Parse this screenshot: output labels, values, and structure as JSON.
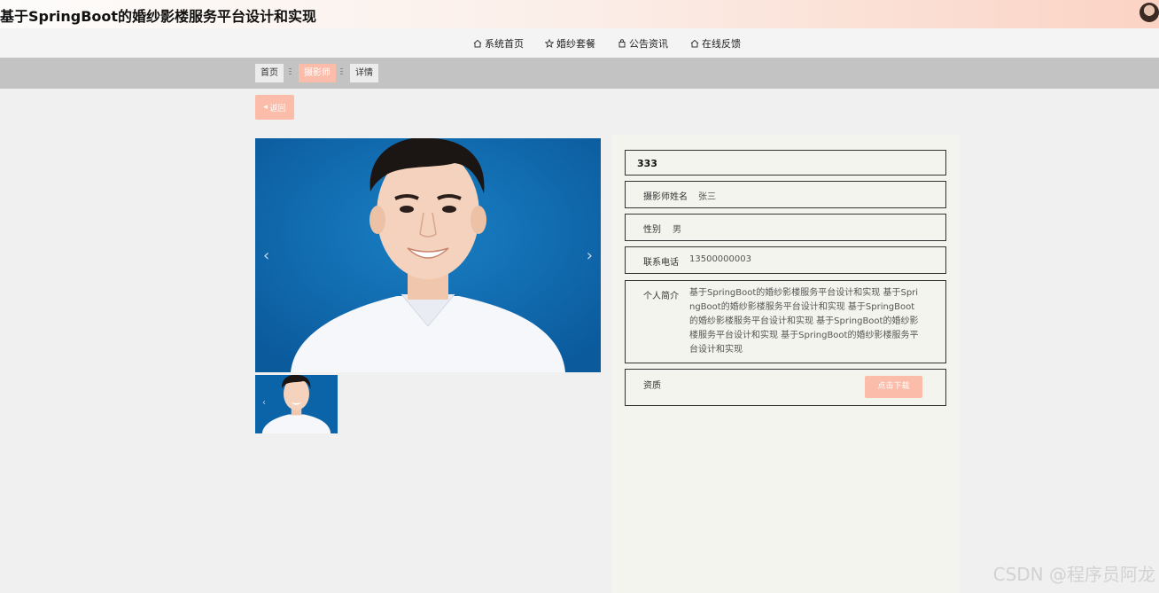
{
  "header": {
    "site_title": "基于SpringBoot的婚纱影楼服务平台设计和实现"
  },
  "nav": {
    "items": [
      {
        "label": "系统首页",
        "icon": "home-icon"
      },
      {
        "label": "婚纱套餐",
        "icon": "star-icon"
      },
      {
        "label": "公告资讯",
        "icon": "bag-icon"
      },
      {
        "label": "在线反馈",
        "icon": "home-icon"
      }
    ]
  },
  "breadcrumb": {
    "items": [
      {
        "label": "首页"
      },
      {
        "label": "摄影师"
      },
      {
        "label": "详情"
      }
    ]
  },
  "back_button": {
    "label": "返回"
  },
  "detail": {
    "title": "333",
    "name_label": "摄影师姓名",
    "name_value": "张三",
    "gender_label": "性别",
    "gender_value": "男",
    "phone_label": "联系电话",
    "phone_value": "13500000003",
    "intro_label": "个人简介",
    "intro_value": "基于SpringBoot的婚纱影楼服务平台设计和实现 基于SpringBoot的婚纱影楼服务平台设计和实现 基于SpringBoot的婚纱影楼服务平台设计和实现 基于SpringBoot的婚纱影楼服务平台设计和实现 基于SpringBoot的婚纱影楼服务平台设计和实现",
    "cert_label": "资质",
    "download_label": "点击下载"
  },
  "watermark": "CSDN @程序员阿龙",
  "colors": {
    "accent": "#fbbcaa",
    "photo_bg": "#0b63a8"
  }
}
